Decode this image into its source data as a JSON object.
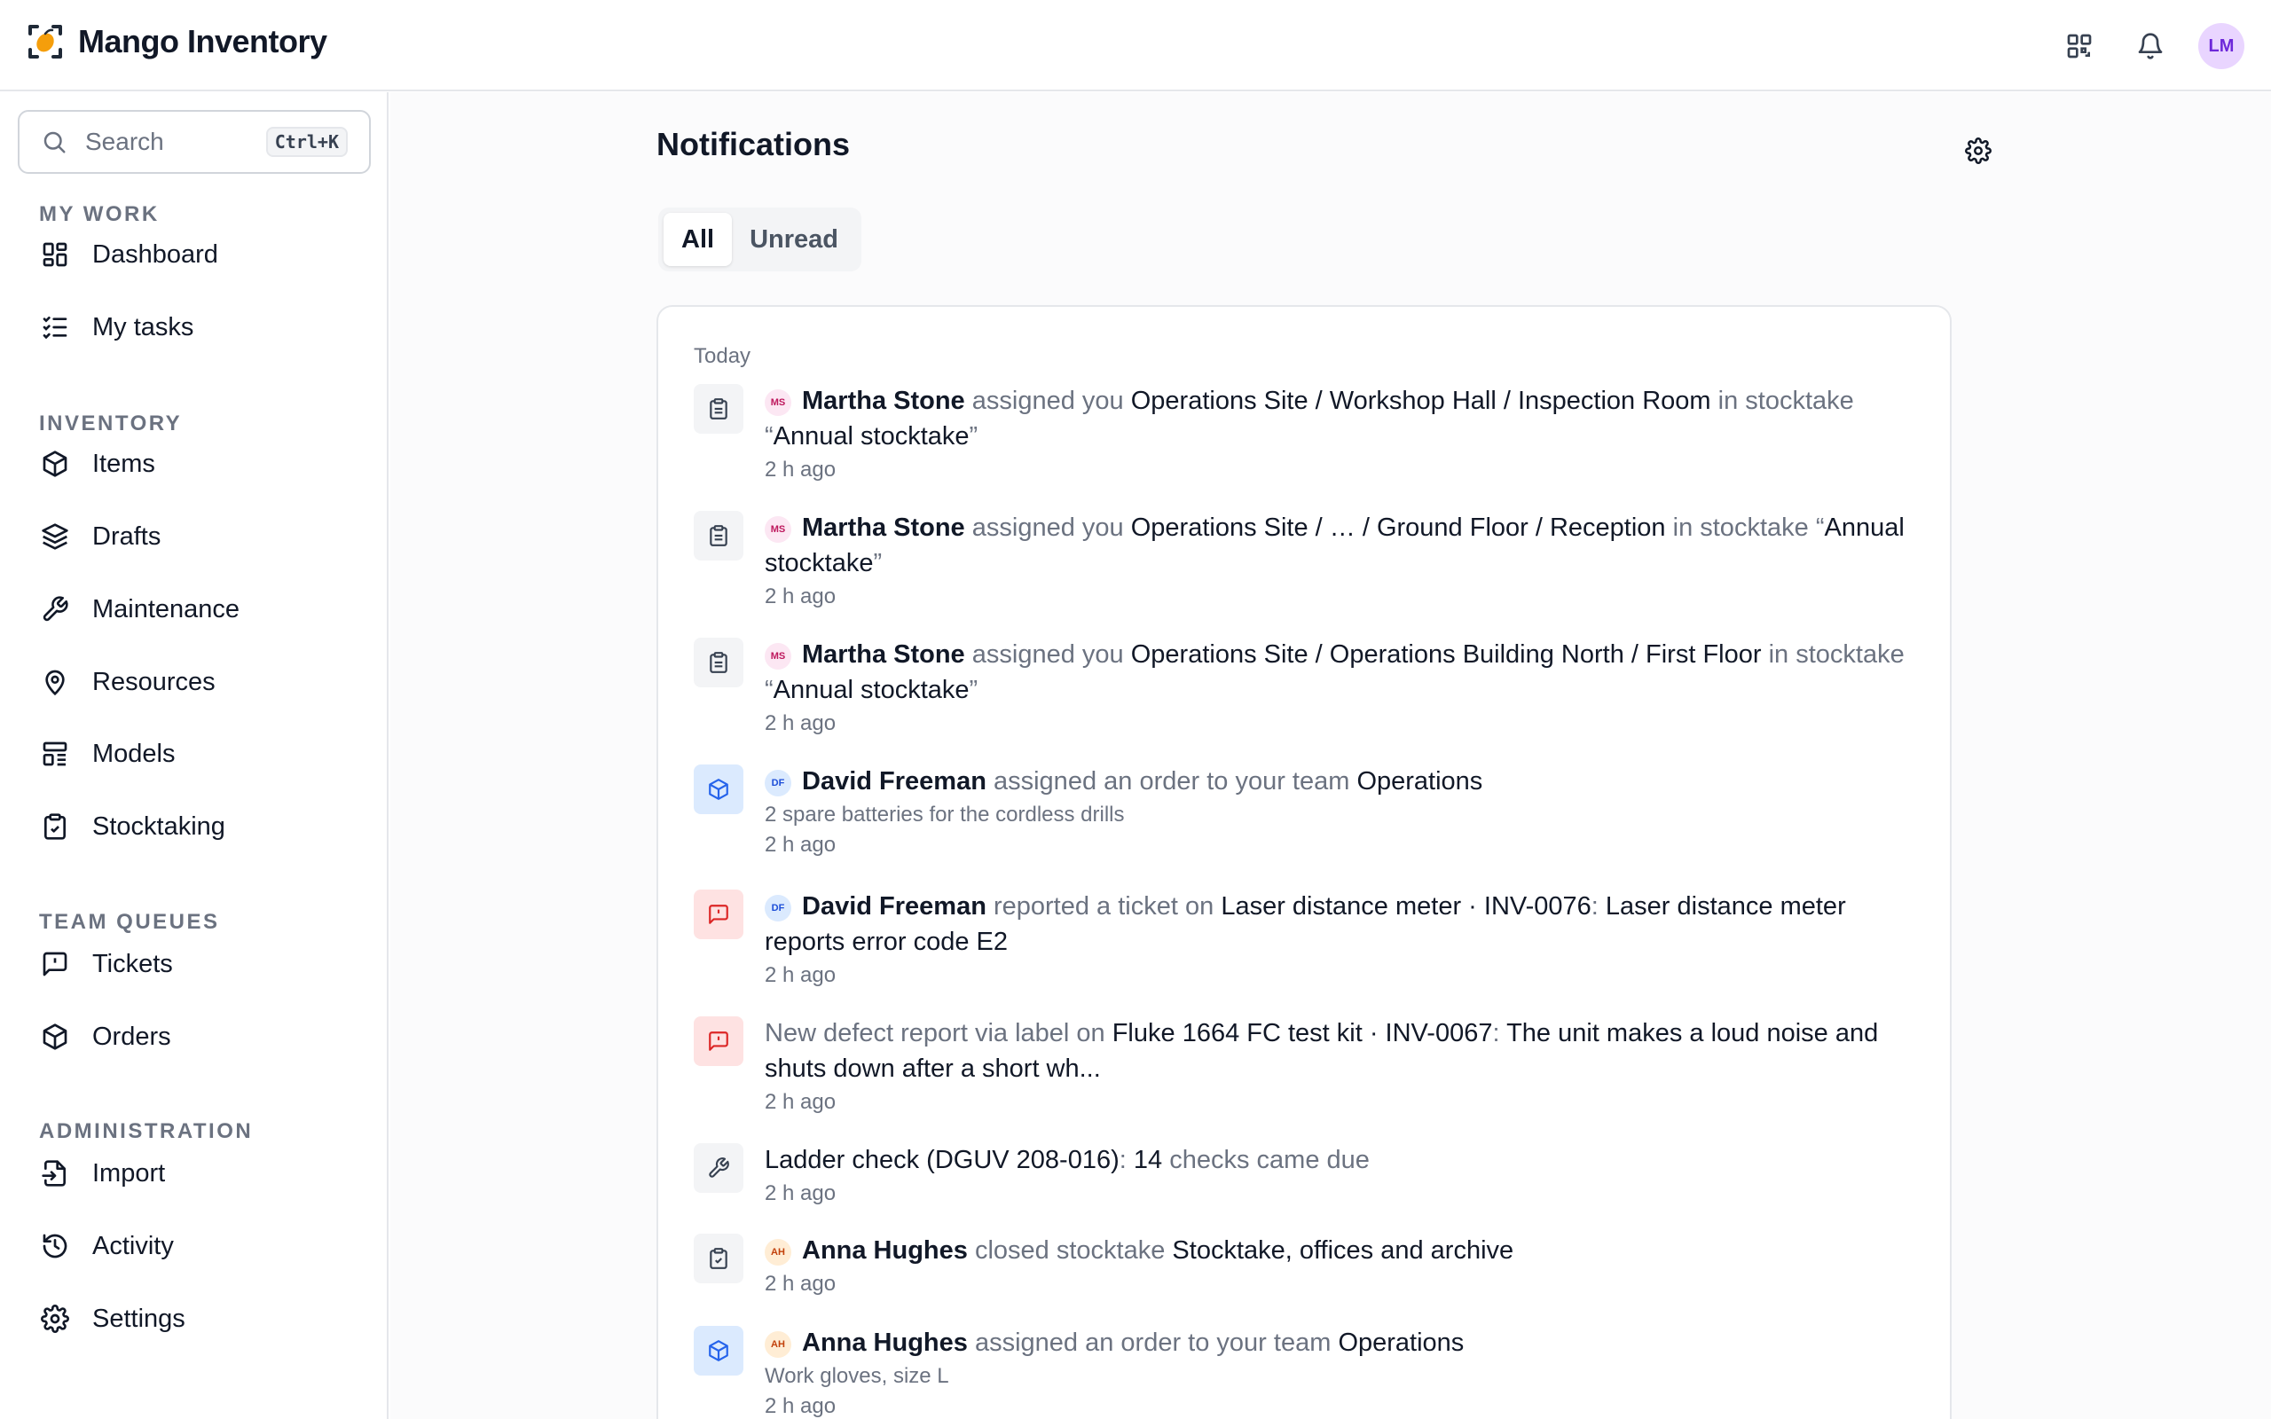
{
  "app": {
    "name": "Mango Inventory",
    "avatar_initials": "LM"
  },
  "search": {
    "placeholder": "Search",
    "shortcut": "Ctrl+K"
  },
  "sidebar": {
    "sections": [
      {
        "label": "MY WORK",
        "items": [
          {
            "label": "Dashboard",
            "icon": "dashboard-icon"
          },
          {
            "label": "My tasks",
            "icon": "tasks-icon"
          }
        ]
      },
      {
        "label": "INVENTORY",
        "items": [
          {
            "label": "Items",
            "icon": "box-icon"
          },
          {
            "label": "Drafts",
            "icon": "layers-icon"
          },
          {
            "label": "Maintenance",
            "icon": "wrench-icon"
          },
          {
            "label": "Resources",
            "icon": "location-icon"
          },
          {
            "label": "Models",
            "icon": "layout-icon"
          },
          {
            "label": "Stocktaking",
            "icon": "clipboard-check-icon"
          }
        ]
      },
      {
        "label": "TEAM QUEUES",
        "items": [
          {
            "label": "Tickets",
            "icon": "ticket-icon"
          },
          {
            "label": "Orders",
            "icon": "box-icon"
          }
        ]
      },
      {
        "label": "ADMINISTRATION",
        "items": [
          {
            "label": "Import",
            "icon": "import-icon"
          },
          {
            "label": "Activity",
            "icon": "history-icon"
          },
          {
            "label": "Settings",
            "icon": "gear-icon"
          }
        ]
      }
    ]
  },
  "main": {
    "title": "Notifications",
    "tabs": [
      {
        "label": "All",
        "active": true
      },
      {
        "label": "Unread",
        "active": false
      }
    ],
    "group_label": "Today",
    "notifications": [
      {
        "icon": "clipboard-icon",
        "initials": "MS",
        "actor": "Martha Stone",
        "verb": "assigned you",
        "object": "Operations Site / Workshop Hall / Inspection Room",
        "prep": "in stocktake",
        "quote_open": "“",
        "target": "Annual stocktake",
        "quote_close": "”",
        "time": "2 h ago"
      },
      {
        "icon": "clipboard-icon",
        "initials": "MS",
        "actor": "Martha Stone",
        "verb": "assigned you",
        "object": "Operations Site / … / Ground Floor / Reception",
        "prep": "in stocktake",
        "quote_open": "“",
        "target": "Annual stocktake",
        "quote_close": "”",
        "time": "2 h ago"
      },
      {
        "icon": "clipboard-icon",
        "initials": "MS",
        "actor": "Martha Stone",
        "verb": "assigned you",
        "object": "Operations Site / Operations Building North / First Floor",
        "prep": "in stocktake",
        "quote_open": "“",
        "target": "Annual stocktake",
        "quote_close": "”",
        "time": "2 h ago"
      },
      {
        "icon": "box-icon",
        "initials": "DF",
        "actor": "David Freeman",
        "verb": "assigned an order to your team",
        "object": "Operations",
        "sub": "2 spare batteries for the cordless drills",
        "time": "2 h ago"
      },
      {
        "icon": "ticket-icon",
        "initials": "DF",
        "actor": "David Freeman",
        "verb": "reported a ticket on",
        "object": "Laser distance meter · INV-0076",
        "colon": ":",
        "detail": "Laser distance meter reports error code E2",
        "time": "2 h ago"
      },
      {
        "icon": "ticket-icon",
        "lead": "New defect report via label on",
        "object": "Fluke 1664 FC test kit · INV-0067",
        "colon": ":",
        "detail": "The unit makes a loud noise and shuts down after a short wh...",
        "time": "2 h ago"
      },
      {
        "icon": "wrench-icon",
        "object": "Ladder check (DGUV 208-016)",
        "colon": ":",
        "count": "14",
        "verb": "checks came due",
        "time": "2 h ago"
      },
      {
        "icon": "clipboard-check-icon",
        "initials": "AH",
        "actor": "Anna Hughes",
        "verb": "closed stocktake",
        "object": "Stocktake, offices and archive",
        "time": "2 h ago"
      },
      {
        "icon": "box-icon",
        "initials": "AH",
        "actor": "Anna Hughes",
        "verb": "assigned an order to your team",
        "object": "Operations",
        "sub": "Work gloves, size L",
        "time": "2 h ago"
      }
    ]
  }
}
